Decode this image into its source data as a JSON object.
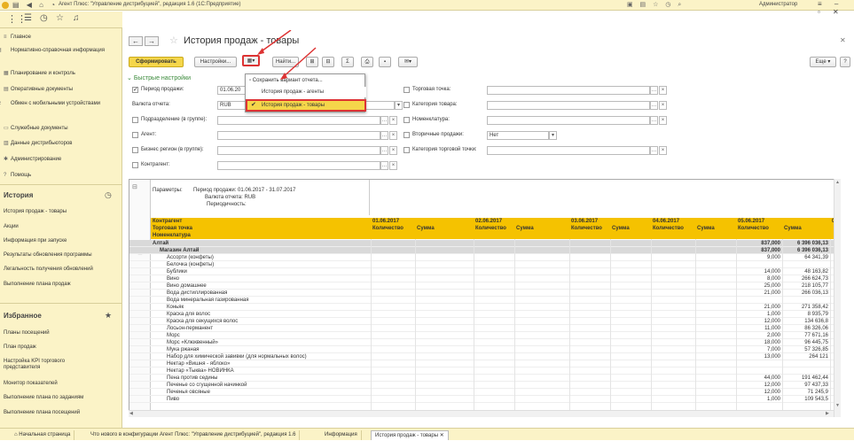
{
  "window": {
    "title": "Агент Плюс: \"Управление дистрибуцией\", редакция 1.6 (1С:Предприятие)",
    "user": "Администратор"
  },
  "sidebar": {
    "items": [
      {
        "label": "Главное",
        "icon": "home-icon"
      },
      {
        "label": "Нормативно-справочная информация",
        "icon": "book-icon"
      },
      {
        "label": "Планирование и контроль",
        "icon": "plan-icon"
      },
      {
        "label": "Оперативные документы",
        "icon": "docs-icon"
      },
      {
        "label": "Обмен с мобильными устройствами",
        "icon": "sync-icon"
      },
      {
        "label": "Служебные документы",
        "icon": "folder-icon"
      },
      {
        "label": "Данные дистрибьюторов",
        "icon": "data-icon"
      },
      {
        "label": "Администрирование",
        "icon": "gear-icon"
      },
      {
        "label": "Помощь",
        "icon": "help-icon"
      }
    ],
    "history_title": "История",
    "history": [
      "История продаж - товары",
      "Акции",
      "Информация при запуске",
      "Результаты обновления программы",
      "Легальность получения обновлений",
      "Выполнение плана продаж"
    ],
    "favorites_title": "Избранное",
    "favorites": [
      "Планы посещений",
      "План продаж",
      "Настройка KPI торгового представителя",
      "Монитор показателей",
      "Выполнение плана по заданиям",
      "Выполнение плана посещений"
    ]
  },
  "form": {
    "title": "История продаж - товары",
    "generate": "Сформировать",
    "settings": "Настройки...",
    "find": "Найти...",
    "more": "Еще",
    "quick_settings": "Быстрые настройки",
    "help": "?"
  },
  "menu": {
    "save": "Сохранить вариант отчета...",
    "agents": "История продаж - агенты",
    "goods": "История продаж - товары"
  },
  "filters": {
    "period_label": "Период продажи:",
    "period_value": "01.06.20",
    "currency_label": "Валюта отчета:",
    "currency_value": "RUB",
    "division": "Подразделение (в группе):",
    "agent": "Агент:",
    "region": "Бизнес регион (в группе):",
    "counterparty": "Контрагент:",
    "outlet": "Торговая точка:",
    "category": "Категория товара:",
    "nomenclature": "Номенклатура:",
    "secondary": "Вторичные продажи:",
    "secondary_value": "Нет",
    "outlet_category": "Категория торговой точки:"
  },
  "report": {
    "params_label": "Параметры:",
    "params": [
      "Период продажи: 01.06.2017 - 31.07.2017",
      "Валюта отчета: RUB",
      "Периодичность:"
    ],
    "head_left": [
      "Контрагент",
      "Торговая точка",
      "Номенклатура"
    ],
    "dates": [
      "01.06.2017",
      "02.06.2017",
      "03.06.2017",
      "04.06.2017",
      "05.06.2017",
      "06"
    ],
    "qty": "Количество",
    "sum": "Сумма",
    "rows": [
      {
        "name": "Алтай",
        "q": "837,000",
        "s": "6 396 036,13",
        "level": 0
      },
      {
        "name": "Магазин Алтай",
        "q": "837,000",
        "s": "6 396 036,13",
        "level": 1
      },
      {
        "name": "Ассорти (конфеты)",
        "q": "9,000",
        "s": "64 341,39",
        "level": 2
      },
      {
        "name": "Белочка (конфеты)",
        "q": "",
        "s": "",
        "level": 2
      },
      {
        "name": "Бублики",
        "q": "14,000",
        "s": "48 163,82",
        "level": 2
      },
      {
        "name": "Вино",
        "q": "8,000",
        "s": "266 624,73",
        "level": 2
      },
      {
        "name": "Вино домашнее",
        "q": "25,000",
        "s": "218 105,77",
        "level": 2
      },
      {
        "name": "Вода дистиллированная",
        "q": "21,000",
        "s": "266 036,13",
        "level": 2
      },
      {
        "name": "Вода минеральная газированная",
        "q": "",
        "s": "",
        "level": 2
      },
      {
        "name": "Коньяк",
        "q": "21,000",
        "s": "271 358,42",
        "level": 2
      },
      {
        "name": "Краска для волос",
        "q": "1,000",
        "s": "8 935,79",
        "level": 2
      },
      {
        "name": "Краска для секущихся волос",
        "q": "12,000",
        "s": "134 636,8",
        "level": 2
      },
      {
        "name": "Лосьон-перманент",
        "q": "11,000",
        "s": "86 326,06",
        "level": 2
      },
      {
        "name": "Морс",
        "q": "2,000",
        "s": "77 671,16",
        "level": 2
      },
      {
        "name": "Морс «Клюквенный»",
        "q": "18,000",
        "s": "96 445,75",
        "level": 2
      },
      {
        "name": "Мука ржаная",
        "q": "7,000",
        "s": "57 326,85",
        "level": 2
      },
      {
        "name": "Набор для химической завивки (для нормальных волос)",
        "q": "13,000",
        "s": "264 121",
        "level": 2
      },
      {
        "name": "Нектар «Вишня - яблоко»",
        "q": "",
        "s": "",
        "level": 2
      },
      {
        "name": "Нектар «Тыква» НОВИНКА",
        "q": "",
        "s": "",
        "level": 2
      },
      {
        "name": "Пена против седины",
        "q": "44,000",
        "s": "191 462,44",
        "level": 2
      },
      {
        "name": "Печенье со сгущенной начинкой",
        "q": "12,000",
        "s": "97 437,33",
        "level": 2
      },
      {
        "name": "Печенья овсяные",
        "q": "12,000",
        "s": "71 245,9",
        "level": 2
      },
      {
        "name": "Пиво",
        "q": "1,000",
        "s": "109 543,5",
        "level": 2
      }
    ]
  },
  "taskbar": {
    "tabs": [
      "Начальная страница",
      "Что нового в конфигурации Агент Плюс: \"Управление дистрибуцией\", редакция 1.6",
      "Информация",
      "История продаж - товары"
    ]
  }
}
